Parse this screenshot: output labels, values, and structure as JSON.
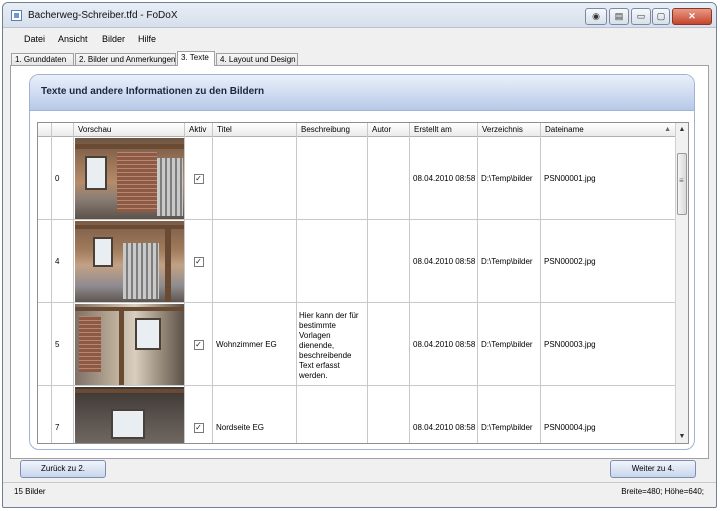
{
  "window": {
    "title": "Bacherweg-Schreiber.tfd - FoDoX",
    "controls": [
      "help-icon",
      "info-icon",
      "minimize-icon",
      "maximize-icon",
      "close-icon"
    ]
  },
  "menu": [
    "Datei",
    "Ansicht",
    "Bilder",
    "Hilfe"
  ],
  "tabs": [
    "1. Grunddaten",
    "2. Bilder und Anmerkungen",
    "3. Texte",
    "4. Layout und Design"
  ],
  "active_tab": "3. Texte",
  "panel": {
    "title": "Texte und andere Informationen zu den Bildern"
  },
  "grid": {
    "columns": [
      "Vorschau",
      "Aktiv",
      "Titel",
      "Beschreibung",
      "Autor",
      "Erstellt am",
      "Verzeichnis",
      "Dateiname"
    ],
    "rows": [
      {
        "id": "0",
        "aktiv": "✓",
        "titel": "",
        "beschreibung": "",
        "autor": "",
        "erstellt": "08.04.2010 08:58",
        "verzeichnis": "D:\\Temp\\bilder",
        "dateiname": "PSN00001.jpg"
      },
      {
        "id": "4",
        "aktiv": "✓",
        "titel": "",
        "beschreibung": "",
        "autor": "",
        "erstellt": "08.04.2010 08:58",
        "verzeichnis": "D:\\Temp\\bilder",
        "dateiname": "PSN00002.jpg"
      },
      {
        "id": "5",
        "aktiv": "✓",
        "titel": "Wohnzimmer EG",
        "beschreibung": "Hier kann der für bestimmte Vorlagen dienende, beschreibende Text erfasst werden.",
        "autor": "",
        "erstellt": "08.04.2010 08:58",
        "verzeichnis": "D:\\Temp\\bilder",
        "dateiname": "PSN00003.jpg"
      },
      {
        "id": "7",
        "aktiv": "✓",
        "titel": "Nordseite EG",
        "beschreibung": "",
        "autor": "",
        "erstellt": "08.04.2010 08:58",
        "verzeichnis": "D:\\Temp\\bilder",
        "dateiname": "PSN00004.jpg"
      }
    ]
  },
  "buttons": {
    "back": "Zurück zu 2.",
    "next": "Weiter zu 4."
  },
  "status": {
    "left": "15 Bilder",
    "right": "Breite=480; Höhe=640;"
  }
}
